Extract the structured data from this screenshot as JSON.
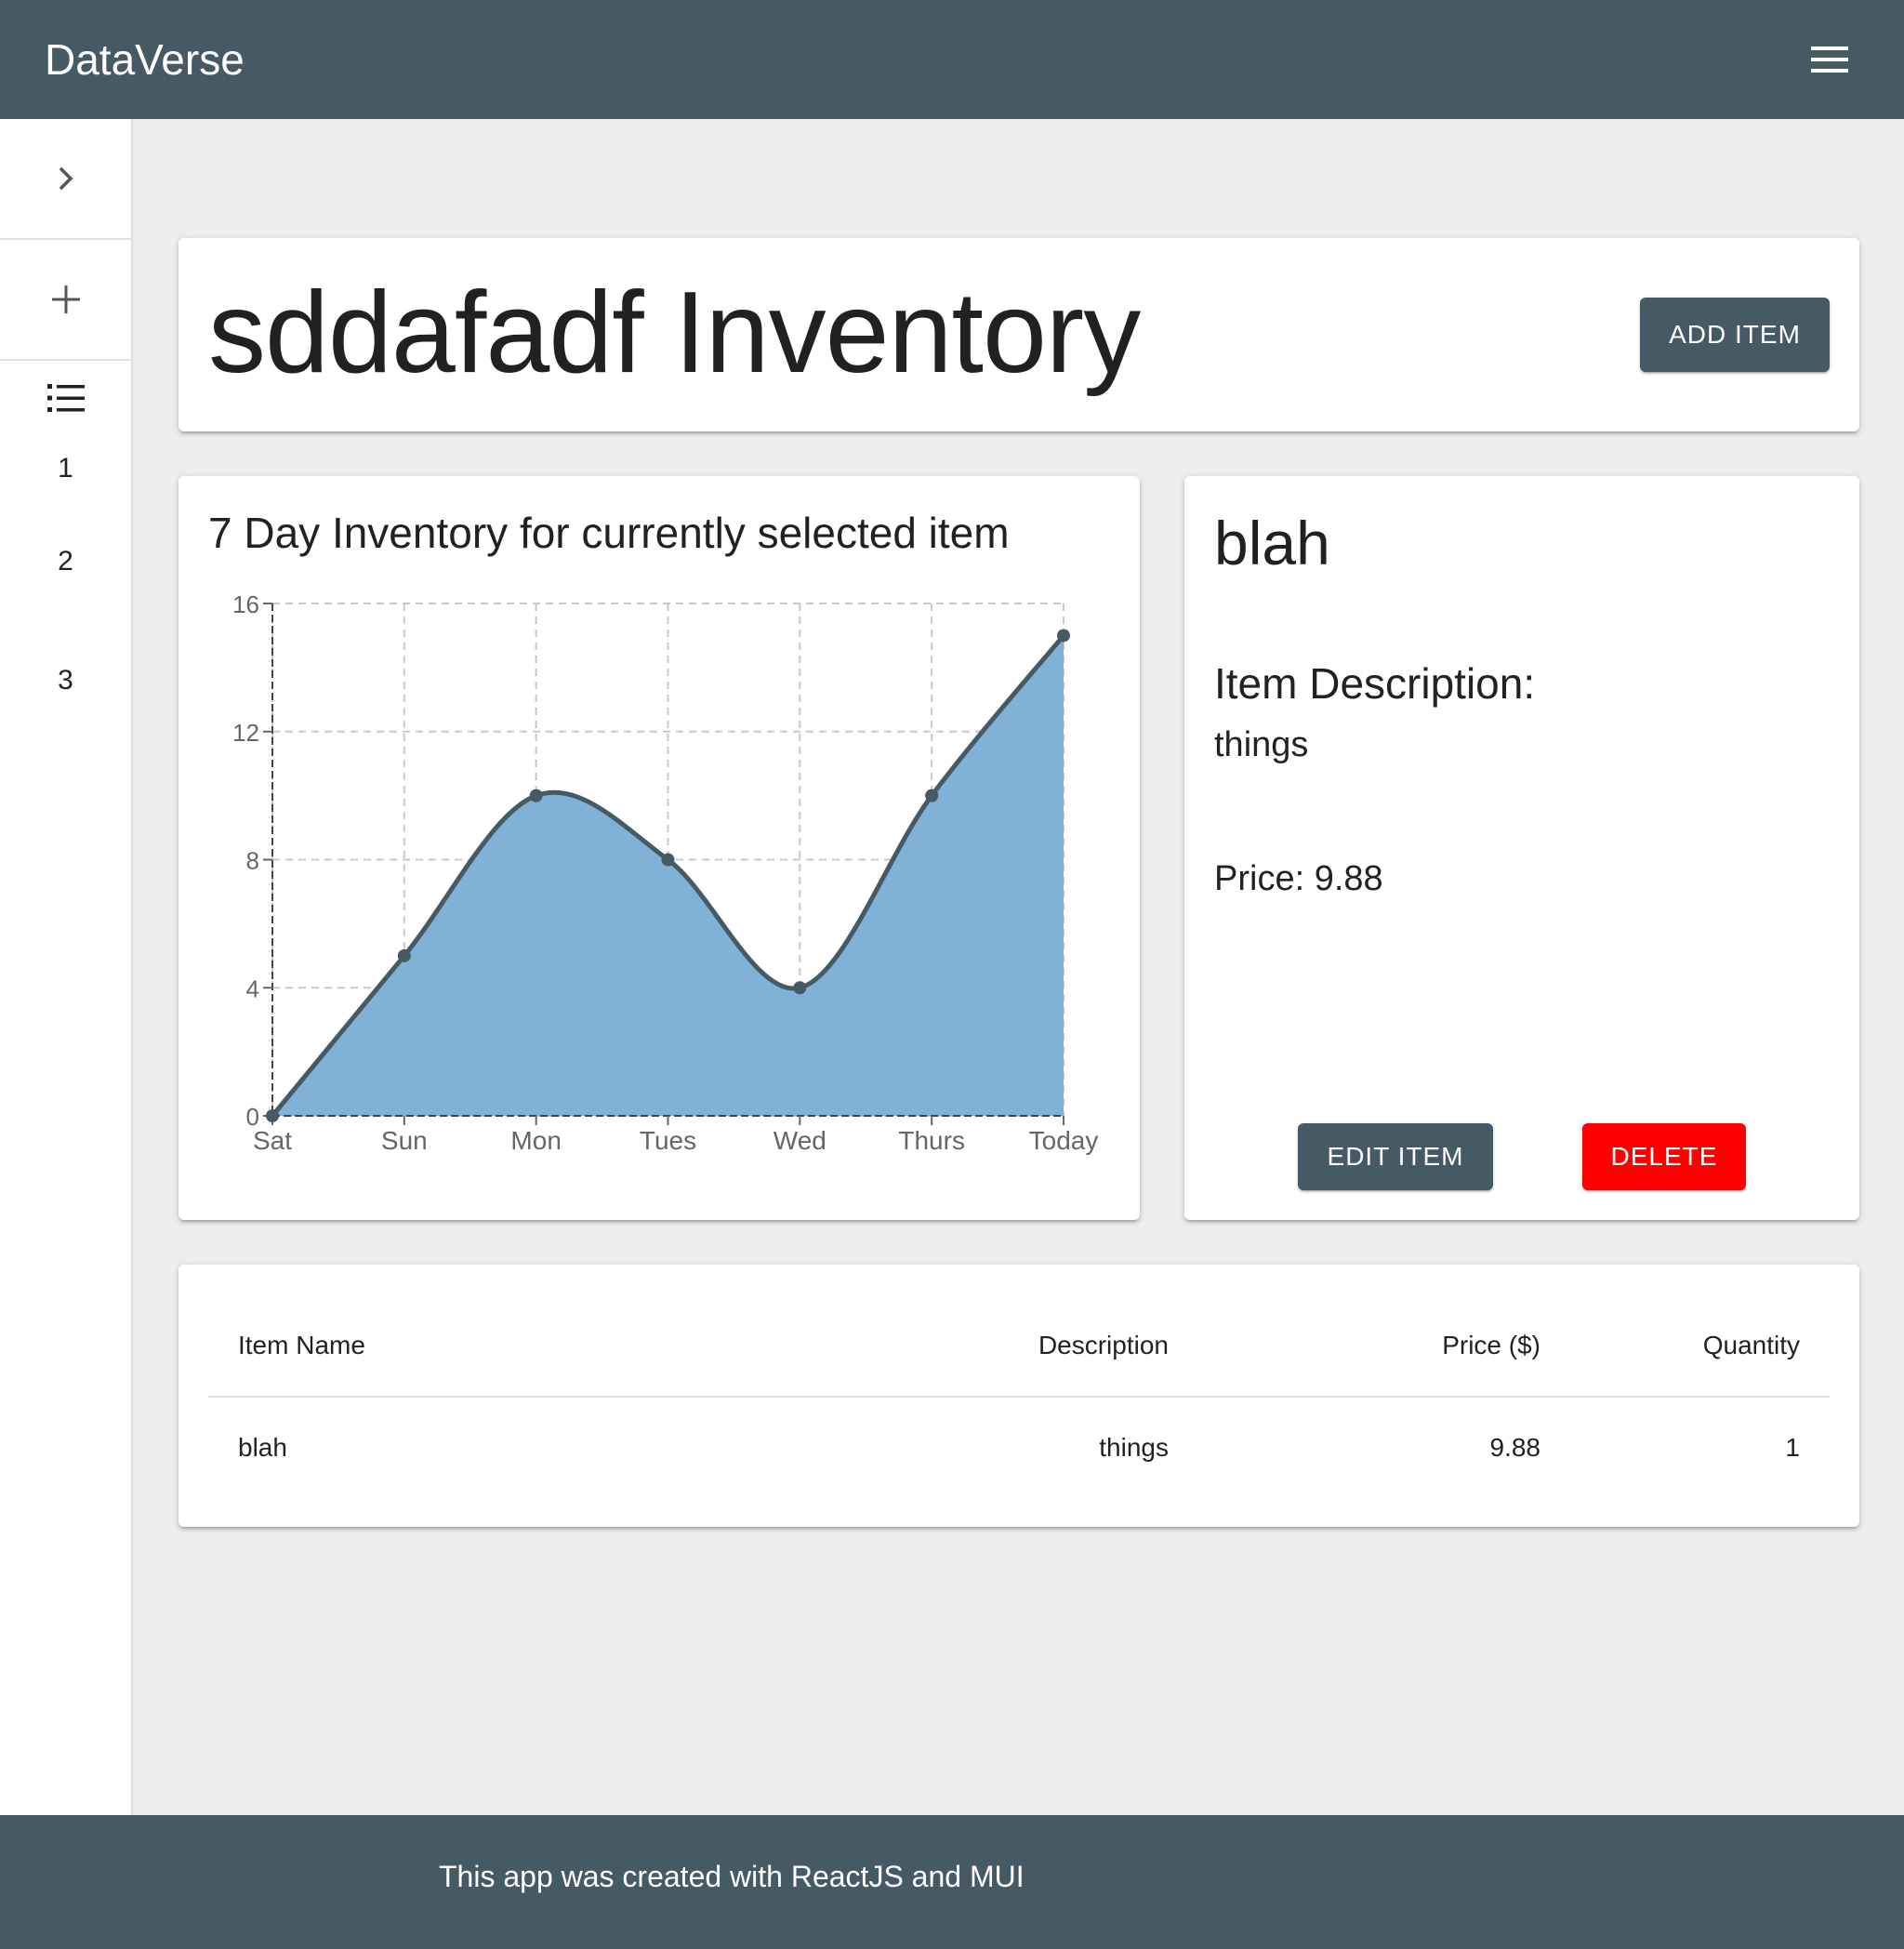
{
  "app": {
    "brand": "DataVerse"
  },
  "sidebar": {
    "items": [
      {
        "label": "1"
      },
      {
        "label": "2"
      },
      {
        "label": "3"
      }
    ]
  },
  "header": {
    "title": "sddafadf Inventory",
    "add_label": "ADD ITEM"
  },
  "chart_data": {
    "type": "area",
    "title": "7 Day Inventory for currently selected item",
    "categories": [
      "Sat",
      "Sun",
      "Mon",
      "Tues",
      "Wed",
      "Thurs",
      "Today"
    ],
    "values": [
      0,
      5,
      10,
      8,
      4,
      10,
      15
    ],
    "ylim": [
      0,
      16
    ],
    "yticks": [
      0,
      4,
      8,
      12,
      16
    ],
    "grid": true,
    "colors": {
      "fill": "#80b1d6",
      "line": "#465a65"
    }
  },
  "detail": {
    "name": "blah",
    "desc_label": "Item Description:",
    "desc_value": "things",
    "price_line": "Price: 9.88",
    "edit_label": "EDIT ITEM",
    "delete_label": "DELETE"
  },
  "table": {
    "headers": [
      "Item Name",
      "Description",
      "Price ($)",
      "Quantity"
    ],
    "rows": [
      [
        "blah",
        "things",
        "9.88",
        "1"
      ]
    ]
  },
  "footer": {
    "text": "This app was created with ReactJS and MUI"
  }
}
